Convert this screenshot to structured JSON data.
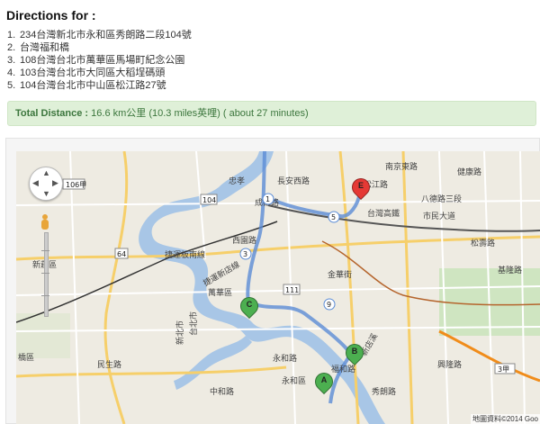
{
  "directions": {
    "heading": "Directions for :",
    "stops": [
      {
        "num": "1.",
        "text": "234台灣新北市永和區秀朗路二段104號"
      },
      {
        "num": "2.",
        "text": "台灣福和橋"
      },
      {
        "num": "3.",
        "text": "108台灣台北市萬華區馬場町紀念公園"
      },
      {
        "num": "4.",
        "text": "103台灣台北市大同區大稻埕碼頭"
      },
      {
        "num": "5.",
        "text": "104台灣台北市中山區松江路27號"
      }
    ]
  },
  "summary": {
    "label": "Total Distance :",
    "value": "16.6 km公里 (10.3 miles英哩) ( about 27 minutes)"
  },
  "map": {
    "zoom_in": "+",
    "zoom_out": "−",
    "markers": {
      "a": {
        "letter": "A",
        "color": "#4caf50"
      },
      "b": {
        "letter": "B",
        "color": "#4caf50"
      },
      "c": {
        "letter": "C",
        "color": "#4caf50"
      },
      "e": {
        "letter": "E",
        "color": "#e53935"
      }
    },
    "labels": {
      "xinzhuang": "新莊區",
      "wanhua": "萬華區",
      "taipei": "台北市",
      "xinbei": "新北市",
      "yonghe": "永和區",
      "banqiao": "橋區",
      "xinyi": "八德路三段",
      "civic": "市民大道",
      "hwy": "台灣高鐵",
      "changan": "長安西路",
      "zhongxiao": "忠孝",
      "jieyun": "捷運板南線",
      "jieyun2": "捷運新店線",
      "songshan": "松壽路",
      "taipeiroad": "台北市",
      "n106": "106甲",
      "n104": "104",
      "n111": "111",
      "n64": "64",
      "n3": "3",
      "n5": "5",
      "n1": "1",
      "n9": "9",
      "n3jia": "3甲",
      "jiankang": "健康路",
      "minquan": "南京東路",
      "xiyuan": "西園路",
      "jinan": "金華街",
      "yonghe_rd": "永和路",
      "zhonghe": "中和路",
      "minsheng": "民生路",
      "chengde": "成都路",
      "keelung": "基隆路",
      "fuhe": "福和路",
      "songjiang": "松江路",
      "xingxin": "秀朗路",
      "xindian": "新店溪",
      "xinglong": "興隆路"
    },
    "attribution": "地圖資料©2014 Goo"
  }
}
